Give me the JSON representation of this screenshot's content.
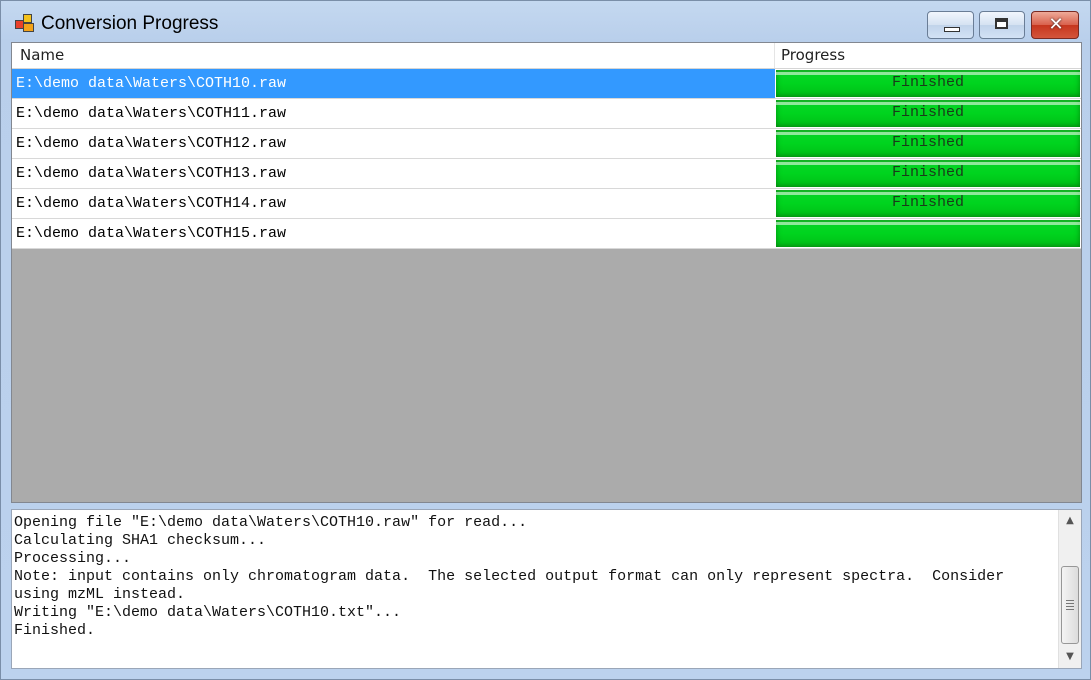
{
  "window": {
    "title": "Conversion Progress",
    "icons": {
      "app": "app-icon",
      "minimize": "minimize-icon",
      "maximize": "maximize-icon",
      "close": "close-icon"
    }
  },
  "list": {
    "columns": {
      "name": "Name",
      "progress": "Progress"
    },
    "rows": [
      {
        "name": "E:\\demo data\\Waters\\COTH10.raw",
        "status": "Finished",
        "progress": 1.0,
        "selected": true
      },
      {
        "name": "E:\\demo data\\Waters\\COTH11.raw",
        "status": "Finished",
        "progress": 1.0,
        "selected": false
      },
      {
        "name": "E:\\demo data\\Waters\\COTH12.raw",
        "status": "Finished",
        "progress": 1.0,
        "selected": false
      },
      {
        "name": "E:\\demo data\\Waters\\COTH13.raw",
        "status": "Finished",
        "progress": 1.0,
        "selected": false
      },
      {
        "name": "E:\\demo data\\Waters\\COTH14.raw",
        "status": "Finished",
        "progress": 1.0,
        "selected": false
      },
      {
        "name": "E:\\demo data\\Waters\\COTH15.raw",
        "status": "",
        "progress": 1.0,
        "selected": false
      }
    ]
  },
  "log": {
    "lines": [
      "Opening file \"E:\\demo data\\Waters\\COTH10.raw\" for read...",
      "Calculating SHA1 checksum...",
      "Processing...",
      "Note: input contains only chromatogram data.  The selected output format can only represent spectra.  Consider",
      "using mzML instead.",
      "Writing \"E:\\demo data\\Waters\\COTH10.txt\"...",
      "Finished."
    ]
  },
  "colors": {
    "selection": "#3399ff",
    "progress_fill": "#00d41e",
    "list_background": "#ababab"
  }
}
